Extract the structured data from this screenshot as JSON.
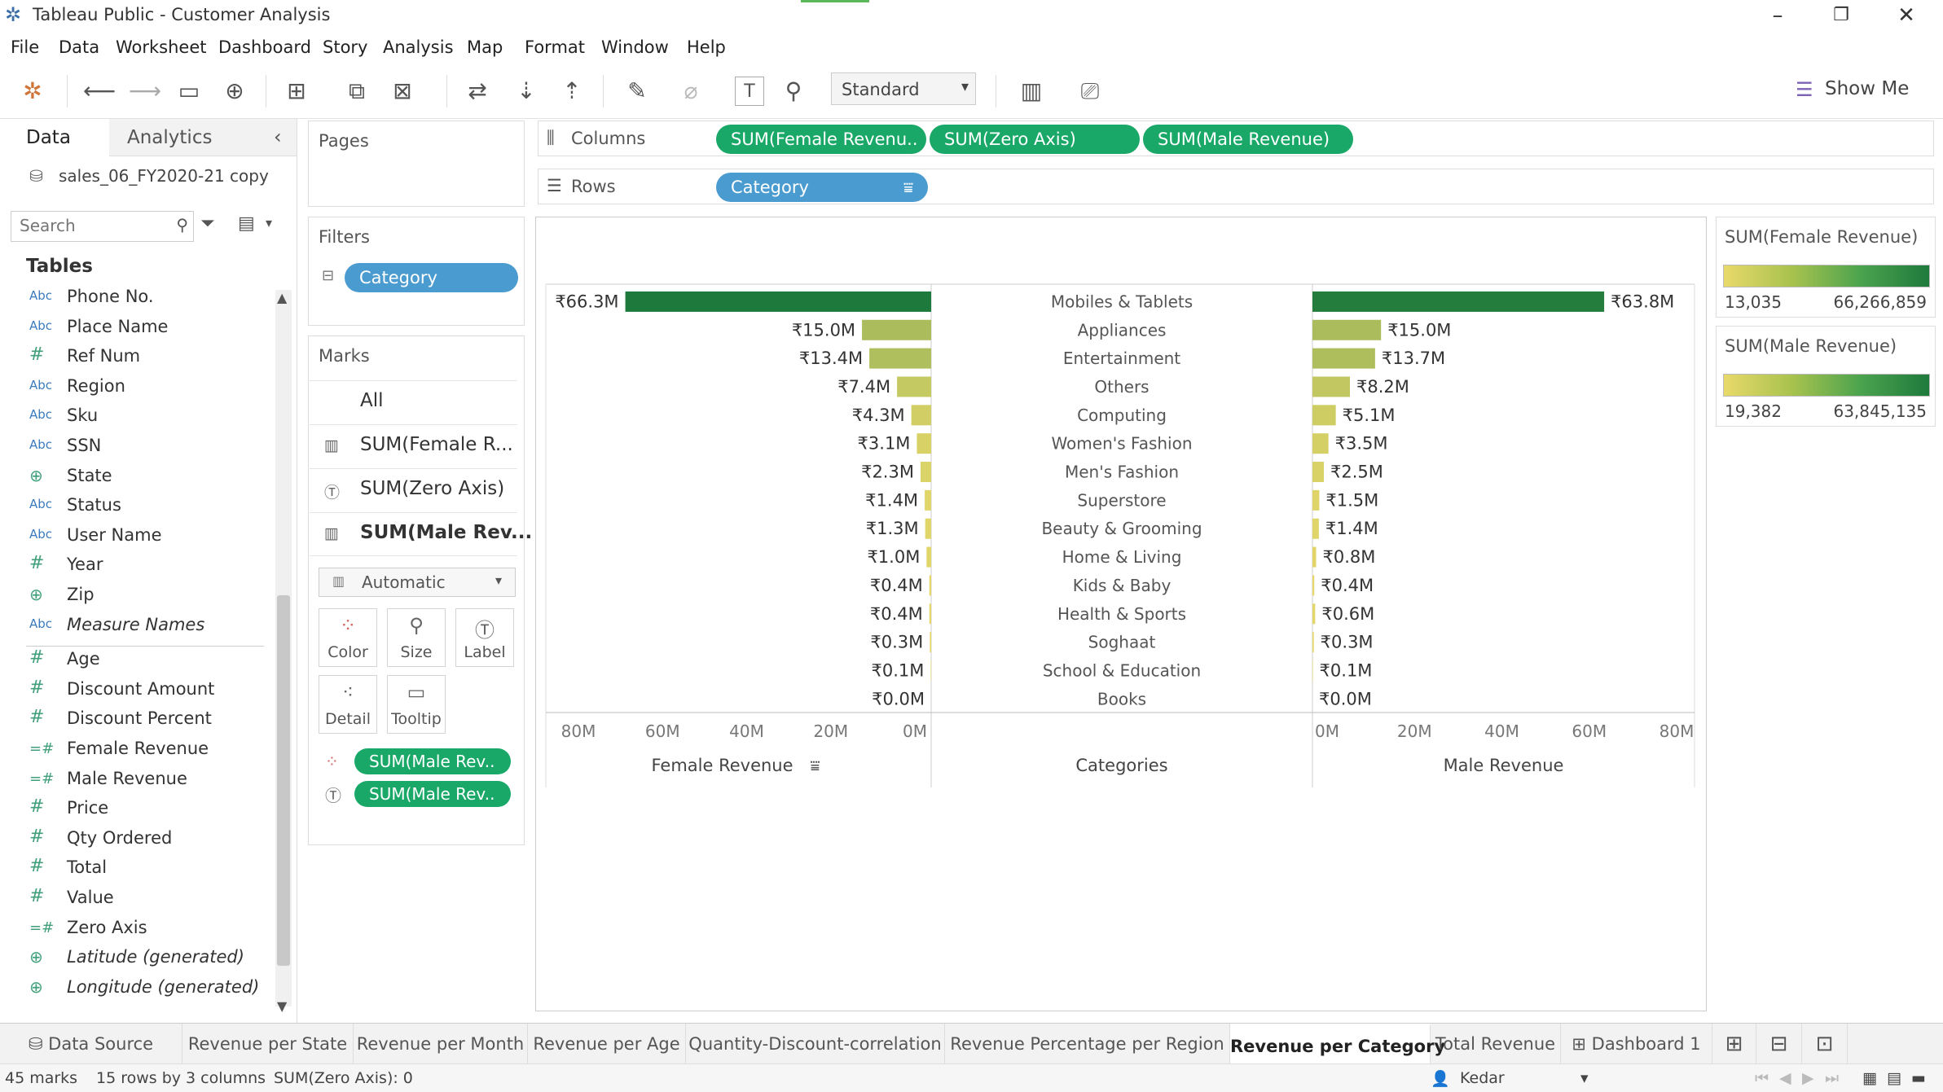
{
  "window": {
    "title": "Tableau Public - Customer Analysis"
  },
  "menu": [
    "File",
    "Data",
    "Worksheet",
    "Dashboard",
    "Story",
    "Analysis",
    "Map",
    "Format",
    "Window",
    "Help"
  ],
  "toolbar": {
    "fit_mode": "Standard",
    "show_me": "Show Me"
  },
  "datapane": {
    "tab_data": "Data",
    "tab_analytics": "Analytics",
    "datasource": "sales_06_FY2020-21 copy",
    "search_placeholder": "Search",
    "tables_header": "Tables",
    "fields": [
      {
        "icon": "Abc",
        "name": "Phone No.",
        "italic": false
      },
      {
        "icon": "Abc",
        "name": "Place Name",
        "italic": false
      },
      {
        "icon": "#",
        "name": "Ref Num",
        "italic": false
      },
      {
        "icon": "Abc",
        "name": "Region",
        "italic": false
      },
      {
        "icon": "Abc",
        "name": "Sku",
        "italic": false
      },
      {
        "icon": "Abc",
        "name": "SSN",
        "italic": false
      },
      {
        "icon": "globe",
        "name": "State",
        "italic": false
      },
      {
        "icon": "Abc",
        "name": "Status",
        "italic": false
      },
      {
        "icon": "Abc",
        "name": "User Name",
        "italic": false
      },
      {
        "icon": "#",
        "name": "Year",
        "italic": false
      },
      {
        "icon": "globe",
        "name": "Zip",
        "italic": false
      },
      {
        "icon": "Abc",
        "name": "Measure Names",
        "italic": true
      },
      {
        "icon": "#",
        "name": "Age",
        "italic": false
      },
      {
        "icon": "#",
        "name": "Discount Amount",
        "italic": false
      },
      {
        "icon": "#",
        "name": "Discount Percent",
        "italic": false
      },
      {
        "icon": "=#",
        "name": "Female Revenue",
        "italic": false
      },
      {
        "icon": "=#",
        "name": "Male Revenue",
        "italic": false
      },
      {
        "icon": "#",
        "name": "Price",
        "italic": false
      },
      {
        "icon": "#",
        "name": "Qty Ordered",
        "italic": false
      },
      {
        "icon": "#",
        "name": "Total",
        "italic": false
      },
      {
        "icon": "#",
        "name": "Value",
        "italic": false
      },
      {
        "icon": "=#",
        "name": "Zero Axis",
        "italic": false
      },
      {
        "icon": "globe",
        "name": "Latitude (generated)",
        "italic": true
      },
      {
        "icon": "globe",
        "name": "Longitude (generated)",
        "italic": true
      }
    ]
  },
  "cards": {
    "pages_title": "Pages",
    "filters_title": "Filters",
    "filter_pill": "Category",
    "marks_title": "Marks",
    "marks_rows": [
      "All",
      "SUM(Female R...",
      "SUM(Zero Axis)",
      "SUM(Male Rev..."
    ],
    "mark_type": "Automatic",
    "mark_buttons": [
      "Color",
      "Size",
      "Label",
      "Detail",
      "Tooltip"
    ],
    "mark_pills": [
      "SUM(Male Rev..",
      "SUM(Male Rev.."
    ]
  },
  "shelves": {
    "columns_label": "Columns",
    "rows_label": "Rows",
    "columns_pills": [
      "SUM(Female Revenu..",
      "SUM(Zero Axis)",
      "SUM(Male Revenue)"
    ],
    "rows_pills": [
      "Category"
    ]
  },
  "legends": [
    {
      "title": "SUM(Female Revenue)",
      "min": "13,035",
      "max": "66,266,859"
    },
    {
      "title": "SUM(Male Revenue)",
      "min": "19,382",
      "max": "63,845,135"
    }
  ],
  "chart_data": {
    "type": "bar",
    "categories": [
      "Mobiles & Tablets",
      "Appliances",
      "Entertainment",
      "Others",
      "Computing",
      "Women's Fashion",
      "Men's Fashion",
      "Superstore",
      "Beauty & Grooming",
      "Home & Living",
      "Kids & Baby",
      "Health & Sports",
      "Soghaat",
      "School & Education",
      "Books"
    ],
    "series": [
      {
        "name": "Female Revenue",
        "values": [
          66.3,
          15.0,
          13.4,
          7.4,
          4.3,
          3.1,
          2.3,
          1.4,
          1.3,
          1.0,
          0.4,
          0.4,
          0.3,
          0.1,
          0.0
        ],
        "labels": [
          "₹66.3M",
          "₹15.0M",
          "₹13.4M",
          "₹7.4M",
          "₹4.3M",
          "₹3.1M",
          "₹2.3M",
          "₹1.4M",
          "₹1.3M",
          "₹1.0M",
          "₹0.4M",
          "₹0.4M",
          "₹0.3M",
          "₹0.1M",
          "₹0.0M"
        ]
      },
      {
        "name": "Male Revenue",
        "values": [
          63.8,
          15.0,
          13.7,
          8.2,
          5.1,
          3.5,
          2.5,
          1.5,
          1.4,
          0.8,
          0.4,
          0.6,
          0.3,
          0.1,
          0.0
        ],
        "labels": [
          "₹63.8M",
          "₹15.0M",
          "₹13.7M",
          "₹8.2M",
          "₹5.1M",
          "₹3.5M",
          "₹2.5M",
          "₹1.5M",
          "₹1.4M",
          "₹0.8M",
          "₹0.4M",
          "₹0.6M",
          "₹0.3M",
          "₹0.1M",
          "₹0.0M"
        ]
      }
    ],
    "female_axis_ticks": [
      "80M",
      "60M",
      "40M",
      "20M",
      "0M"
    ],
    "male_axis_ticks": [
      "0M",
      "20M",
      "40M",
      "60M",
      "80M"
    ],
    "xlabel_left": "Female Revenue",
    "xlabel_center": "Categories",
    "xlabel_right": "Male Revenue",
    "xlim": [
      0,
      80
    ],
    "colors": {
      "low": "#e8d96a",
      "mid": "#a8c24e",
      "high": "#1e7a3c"
    }
  },
  "sheet_tabs": [
    "Data Source",
    "Revenue per State",
    "Revenue per Month",
    "Revenue per Age",
    "Quantity-Discount-correlation",
    "Revenue Percentage per Region",
    "Revenue per Category",
    "Total Revenue",
    "Dashboard 1"
  ],
  "active_tab": "Revenue per Category",
  "status": {
    "marks": "45 marks",
    "dims": "15 rows by 3 columns",
    "sum": "SUM(Zero Axis): 0",
    "user": "Kedar"
  }
}
